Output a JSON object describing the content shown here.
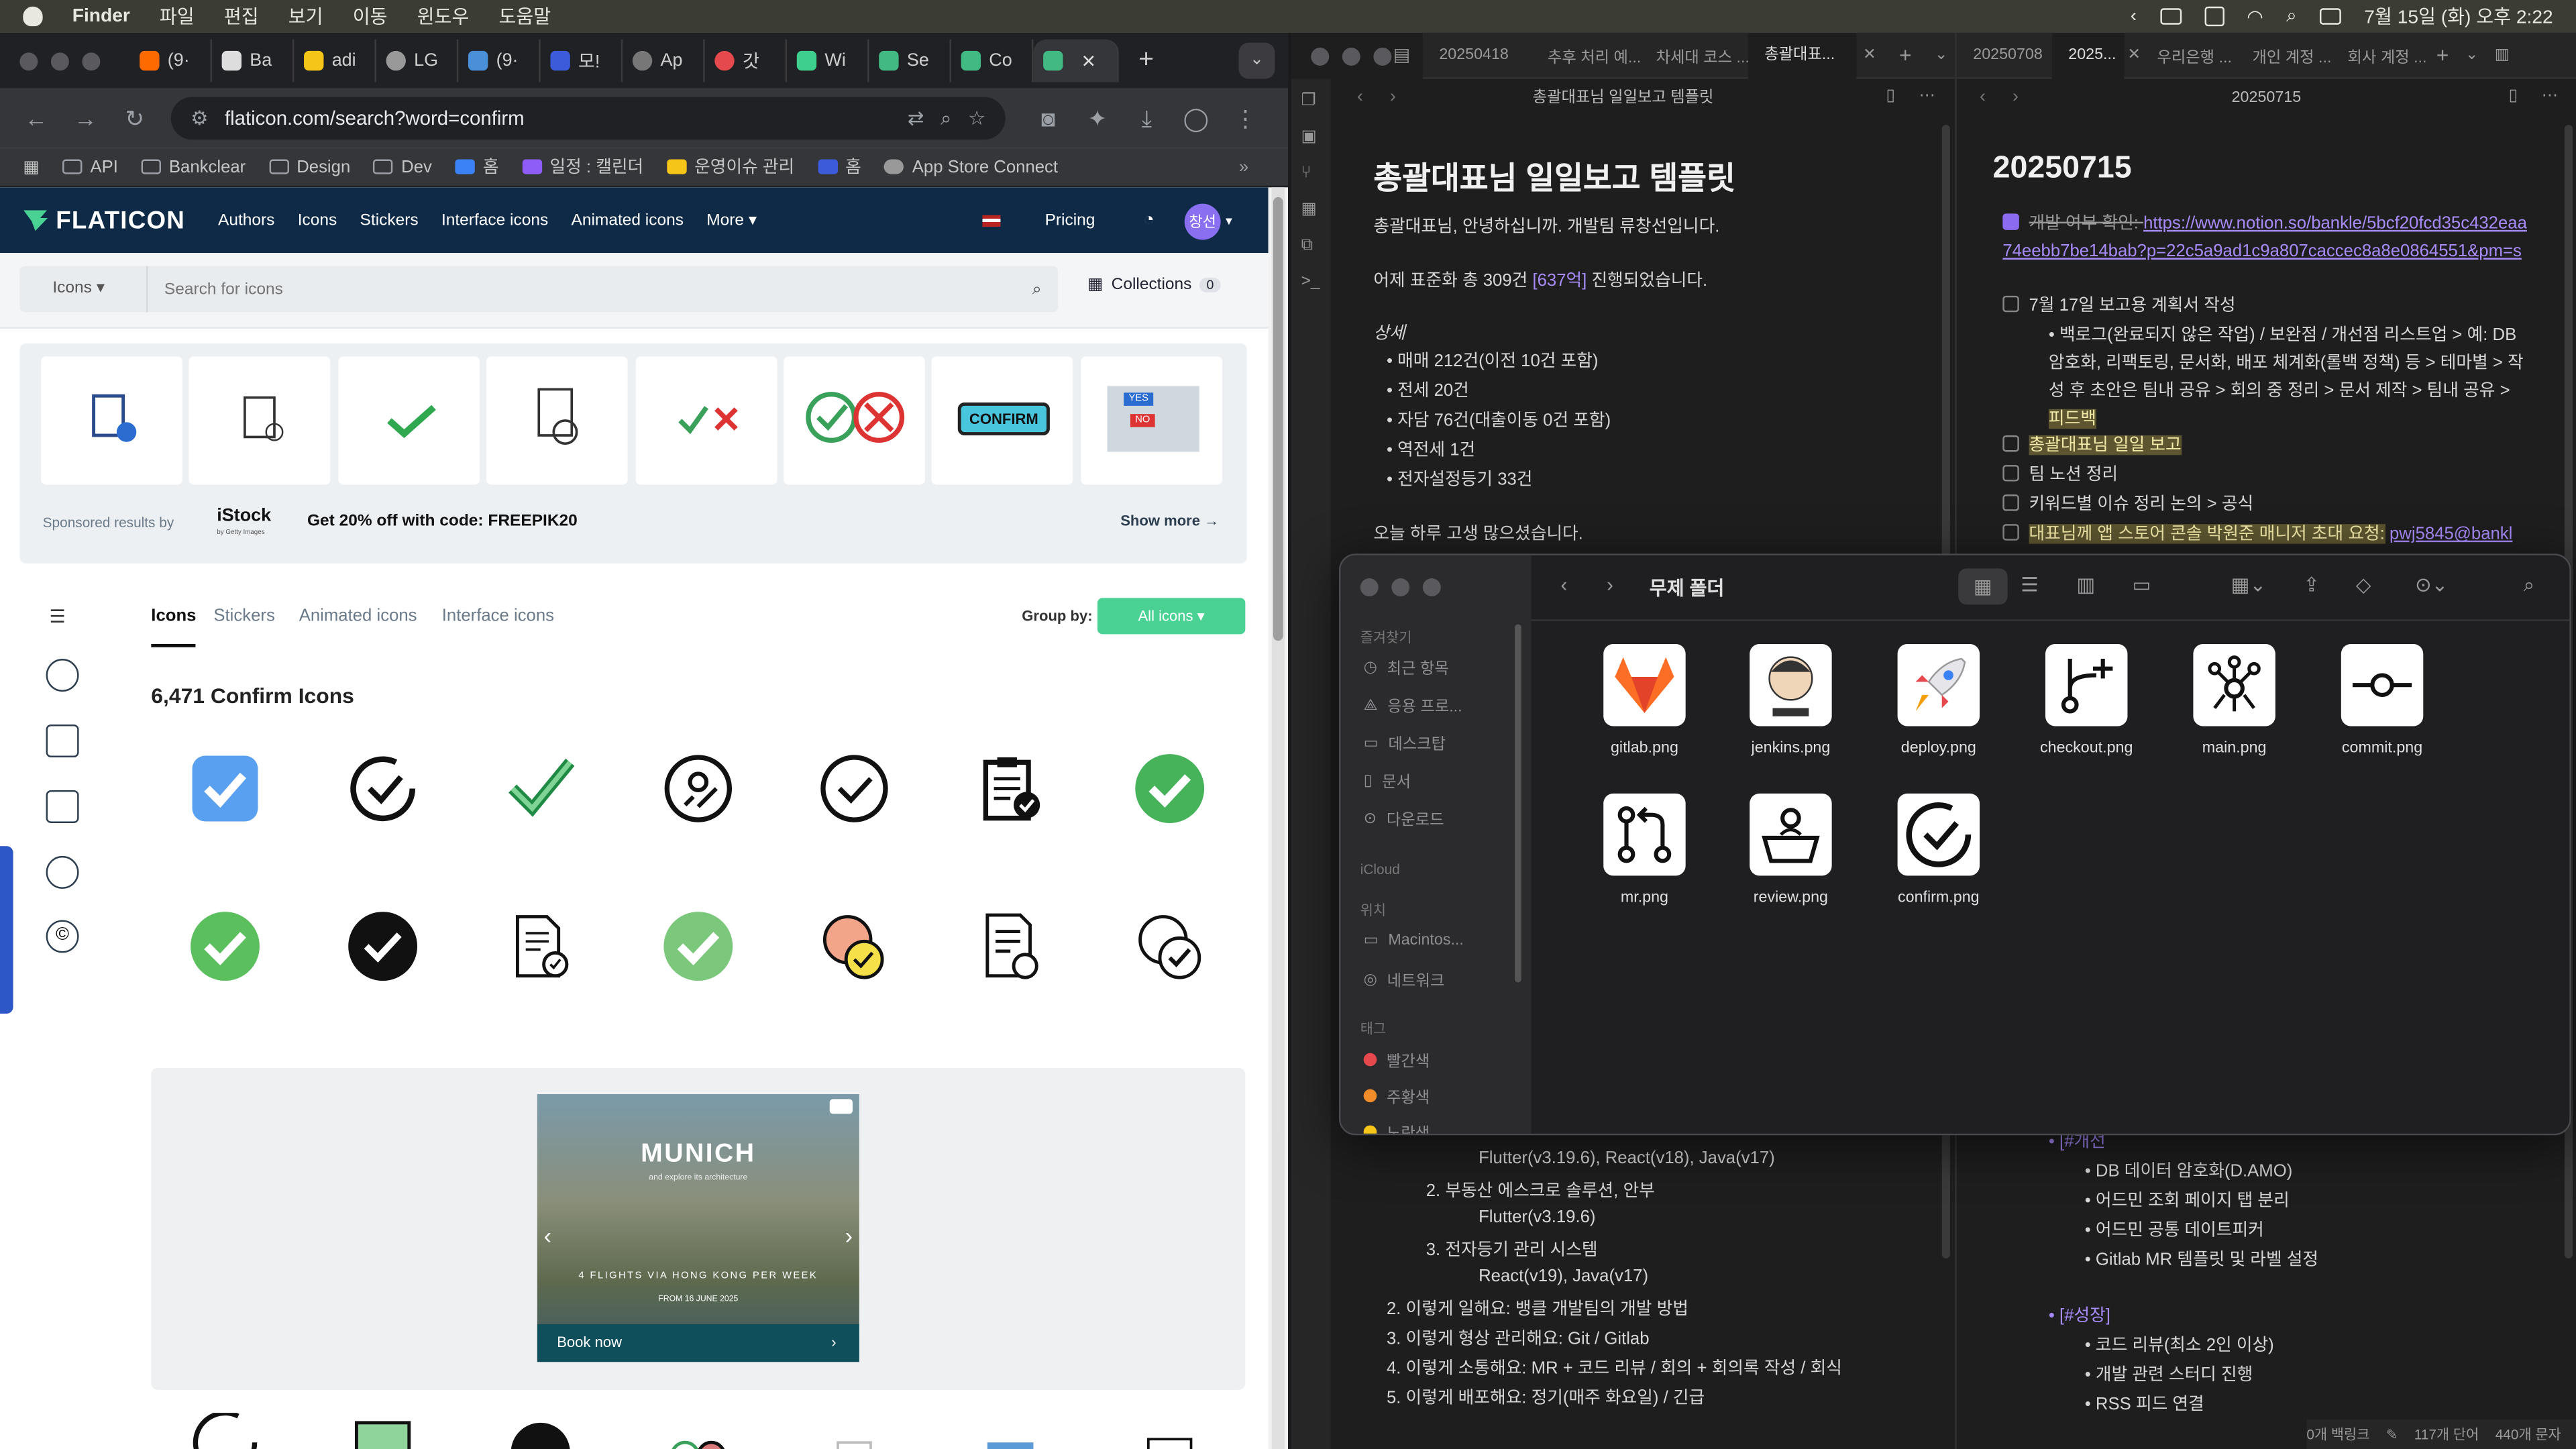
{
  "menubar": {
    "app": "Finder",
    "items": [
      "파일",
      "편집",
      "보기",
      "이동",
      "윈도우",
      "도움말"
    ],
    "clock": "7월 15일 (화) 오후 2:22"
  },
  "chrome": {
    "tabs": [
      "(9·",
      "Ba",
      "adi",
      "LG",
      "(9·",
      "모!",
      "Ap",
      "갓",
      "Wi",
      "Se",
      "Co",
      ""
    ],
    "url": "flaticon.com/search?word=confirm",
    "bookmarks": [
      "API",
      "Bankclear",
      "Design",
      "Dev",
      "홈",
      "일정 : 캘린더",
      "운영이슈 관리",
      "홈",
      "App Store Connect"
    ]
  },
  "flaticon": {
    "brand": "FLATICON",
    "nav": [
      "Authors",
      "Icons",
      "Stickers",
      "Interface icons",
      "Animated icons",
      "More"
    ],
    "pricing": "Pricing",
    "avatar": "창선",
    "search_type": "Icons",
    "search_placeholder": "Search for icons",
    "collections": "Collections",
    "collections_count": "0",
    "sponsored": "Sponsored results by",
    "istock": "iStock",
    "istock_sub": "by Getty Images",
    "promo": "Get 20% off with code: FREEPIK20",
    "show_more": "Show more",
    "confirm_card": "CONFIRM",
    "yes": "YES",
    "no": "NO",
    "tabs": [
      "Icons",
      "Stickers",
      "Animated icons",
      "Interface icons"
    ],
    "group_by": "Group by:",
    "all_icons": "All icons",
    "result_title": "6,471 Confirm Icons",
    "ad": {
      "city": "MUNICH",
      "sub": "and explore its architecture",
      "flights": "4 FLIGHTS VIA HONG KONG PER WEEK",
      "from": "FROM 16 JUNE 2025",
      "cta": "Book now"
    }
  },
  "obsidian_left": {
    "tabs": [
      "20250418",
      "추후 처리 예...",
      "차세대 코스 ...",
      "총괄대표..."
    ],
    "header": "총괄대표님 일일보고 템플릿",
    "title": "총괄대표님 일일보고 템플릿",
    "p1": "총괄대표님, 안녕하십니까. 개발팀 류창선입니다.",
    "p2a": "어제 표준화 총 309건 ",
    "p2b": "[637억]",
    "p2c": " 진행되었습니다.",
    "detail": "상세",
    "bullets": [
      "매매 212건(이전 10건 포함)",
      "전세 20건",
      "자담 76건(대출이동 0건 포함)",
      "역전세 1건",
      "전자설정등기 33건"
    ],
    "closing": "오늘 하루 고생 많으셨습니다.",
    "lower": [
      "Flutter(v3.19.6), React(v18), Java(v17)",
      "2. 부동산 에스크로 솔루션, 안부",
      "Flutter(v3.19.6)",
      "3. 전자등기 관리 시스템",
      "React(v19), Java(v17)",
      "2. 이렇게 일해요: 뱅클 개발팀의 개발 방법",
      "3. 이렇게 형상 관리해요: Git / Gitlab",
      "4. 이렇게 소통해요: MR + 코드 리뷰 / 회의 + 회의록 작성 / 회식",
      "5. 이렇게 배포해요: 정기(매주 화요일) / 긴급"
    ]
  },
  "obsidian_right": {
    "tabs": [
      "20250708",
      "2025...",
      "우리은행 ...",
      "개인 계정 ...",
      "회사 계정 ..."
    ],
    "header": "20250715",
    "title": "20250715",
    "t1": "개발 여부 확인: ",
    "t1link": "https://www.notion.so/bankle/5bcf20fcd35c432eaa74eebb7be14bab?p=22c5a9ad1c9a807caccec8a8e0864551&pm=s",
    "t2": "7월 17일 보고용 계획서 작성",
    "t2sub": "백로그(완료되지 않은 작업) / 보완점 / 개선점 리스트업 > 예: DB 암호화, 리팩토링, 문서화, 배포 체계화(롤백 정책) 등 > 테마별 > 작성 후 초안은 팀내 공유 > 회의 중 정리 > 문서 제작 > 팀내 공유 > ",
    "t2hl": "피드백",
    "t3": "총괄대표님 일일 보고",
    "t4": "팀 노션 정리",
    "t5": "키워드별 이슈 정리 논의 > 공식",
    "t6": "대표님께 앱 스토어 콘솔 박원준 매니저 초대 요청:",
    "t6link": "pwj5845@bankl",
    "tag1": "[#개선",
    "improve": [
      "DB 데이터 암호화(D.AMO)",
      "어드민 조회 페이지 탭 분리",
      "어드민 공통 데이트피커",
      "Gitlab MR 템플릿 및 라벨 설정"
    ],
    "tag2": "[#성장]",
    "grow": [
      "코드 리뷰(최소 2인 이상)",
      "개발 관련 스터디 진행",
      "RSS 피드 연결"
    ],
    "status": [
      "0개 백링크",
      "117개 단어",
      "440개 문자"
    ]
  },
  "finder": {
    "title": "무제 폴더",
    "fav_header": "즐겨찾기",
    "favs": [
      "최근 항목",
      "응용 프로...",
      "데스크탑",
      "문서",
      "다운로드"
    ],
    "icloud": "iCloud",
    "loc_header": "위치",
    "locs": [
      "Macintos...",
      "네트워크"
    ],
    "tag_header": "태그",
    "tags": [
      "빨간색",
      "주황색",
      "노란색"
    ],
    "files": [
      "gitlab.png",
      "jenkins.png",
      "deploy.png",
      "checkout.png",
      "main.png",
      "commit.png",
      "mr.png",
      "review.png",
      "confirm.png"
    ]
  },
  "colors": {
    "flaticon_nav": "#0e2a47",
    "flaticon_green": "#4ad295",
    "obsidian_accent": "#8b6cf0"
  }
}
